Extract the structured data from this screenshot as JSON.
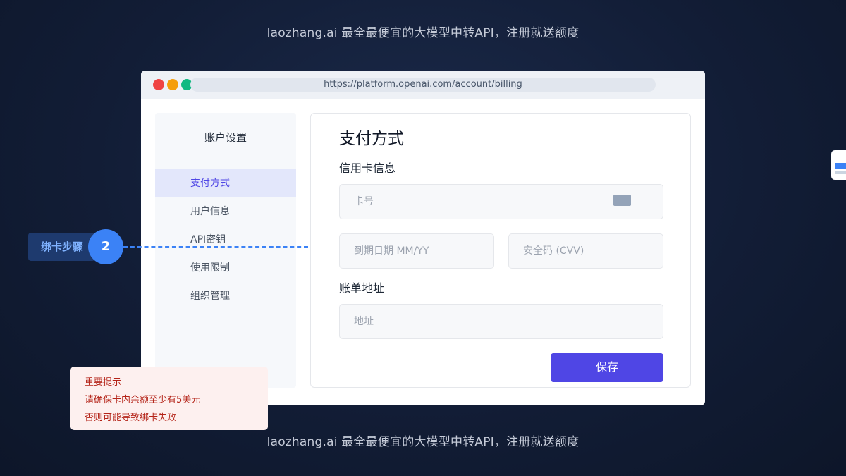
{
  "banner": {
    "top_text": "laozhang.ai 最全最便宜的大模型中转API，注册就送额度",
    "bottom_text": "laozhang.ai 最全最便宜的大模型中转API，注册就送额度"
  },
  "browser": {
    "url": "https://platform.openai.com/account/billing"
  },
  "sidebar": {
    "title": "账户设置",
    "items": [
      {
        "label": "支付方式",
        "active": true
      },
      {
        "label": "用户信息",
        "active": false
      },
      {
        "label": "API密钥",
        "active": false
      },
      {
        "label": "使用限制",
        "active": false
      },
      {
        "label": "组织管理",
        "active": false
      }
    ]
  },
  "main": {
    "title": "支付方式",
    "card_section_label": "信用卡信息",
    "card_number": {
      "value": "",
      "placeholder": "卡号"
    },
    "expiry": {
      "value": "",
      "placeholder": "到期日期 MM/YY"
    },
    "cvv": {
      "value": "",
      "placeholder": "安全码 (CVV)"
    },
    "billing_section_label": "账单地址",
    "address": {
      "value": "",
      "placeholder": "地址"
    },
    "save_label": "保存"
  },
  "annotation": {
    "step_label": "绑卡步骤",
    "step_number": "2"
  },
  "notice": {
    "title": "重要提示",
    "line1": "请确保卡内余额至少有5美元",
    "line2": "否则可能导致绑卡失败"
  },
  "colors": {
    "accent": "#4f46e5",
    "step_blue": "#3b82f6",
    "notice_text": "#b42318",
    "background": "#121d36"
  },
  "icons": [
    "credit-card-icon",
    "window-close-dot",
    "window-minimize-dot",
    "window-maximize-dot"
  ]
}
